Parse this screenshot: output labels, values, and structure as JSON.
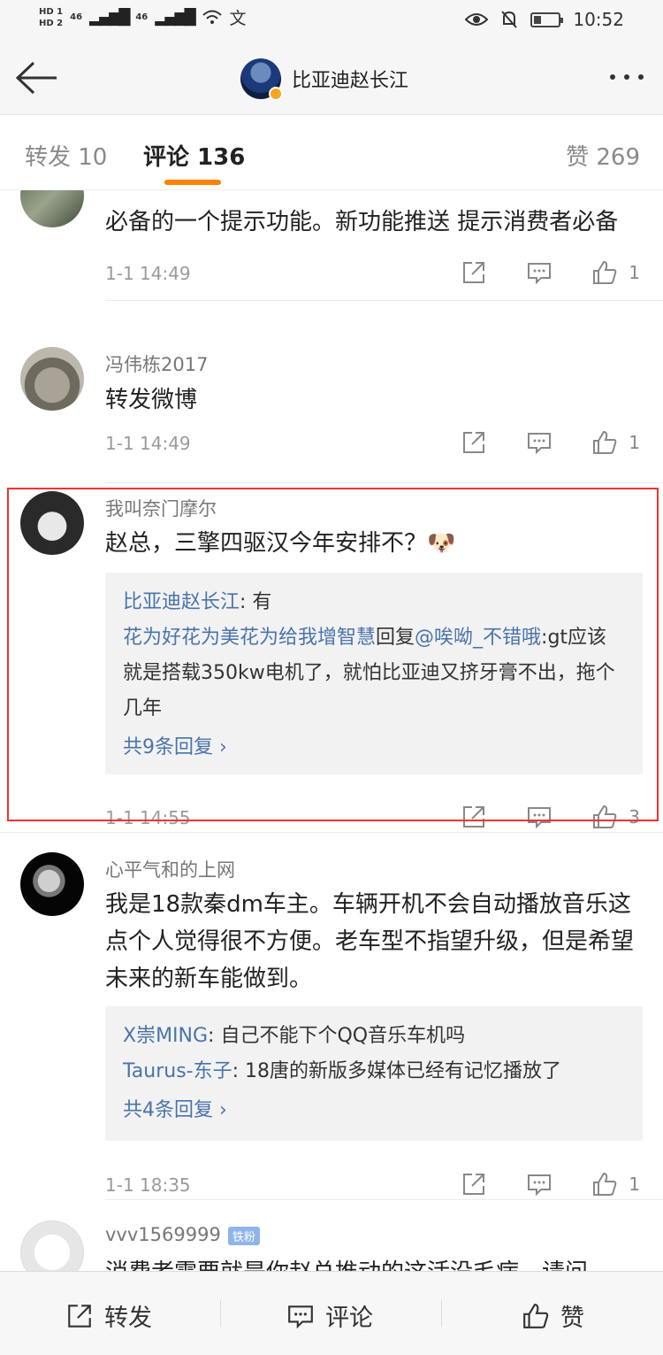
{
  "status_bar": {
    "hd1": "HD 1",
    "hd2": "HD 2",
    "net1": "46",
    "net2": "46",
    "time": "10:52"
  },
  "nav": {
    "title": "比亚迪赵长江"
  },
  "tabs": {
    "repost": "转发 10",
    "comment": "评论 136",
    "like": "赞 269"
  },
  "comments": [
    {
      "user": "",
      "text": "必备的一个提示功能。新功能推送 提示消费者必备",
      "time": "1-1 14:49",
      "likes": "1"
    },
    {
      "user": "冯伟栋2017",
      "text": "转发微博",
      "time": "1-1 14:49",
      "likes": "1"
    },
    {
      "user": "我叫奈门摩尔",
      "text": "赵总，三擎四驱汉今年安排不？🐶",
      "replies": [
        {
          "name": "比亚迪赵长江",
          "text": ": 有"
        },
        {
          "name": "花为好花为美花为给我增智慧",
          "mid": "回复",
          "at": "@唉呦_不错哦",
          "text": ":gt应该就是搭载350kw电机了，就怕比亚迪又挤牙膏不出，拖个几年"
        }
      ],
      "more_replies": "共9条回复 ›",
      "time": "1-1 14:55",
      "likes": "3"
    },
    {
      "user": "心平气和的上网",
      "text": "我是18款秦dm车主。车辆开机不会自动播放音乐这点个人觉得很不方便。老车型不指望升级，但是希望未来的新车能做到。",
      "replies": [
        {
          "name": "X崇MING",
          "text": ": 自己不能下个QQ音乐车机吗"
        },
        {
          "name": "Taurus-东子",
          "text": ": 18唐的新版多媒体已经有记忆播放了"
        }
      ],
      "more_replies": "共4条回复 ›",
      "time": "1-1 18:35",
      "likes": "1"
    },
    {
      "user": "vvv1569999",
      "badge": "铁粉",
      "text": "消费者需要就是你赵总推动的这活没毛病，请问"
    }
  ],
  "bottom_bar": {
    "repost": "转发",
    "comment": "评论",
    "like": "赞"
  },
  "colors": {
    "accent": "#ff8200",
    "link": "#4a74ab",
    "highlight": "#ee3333"
  }
}
